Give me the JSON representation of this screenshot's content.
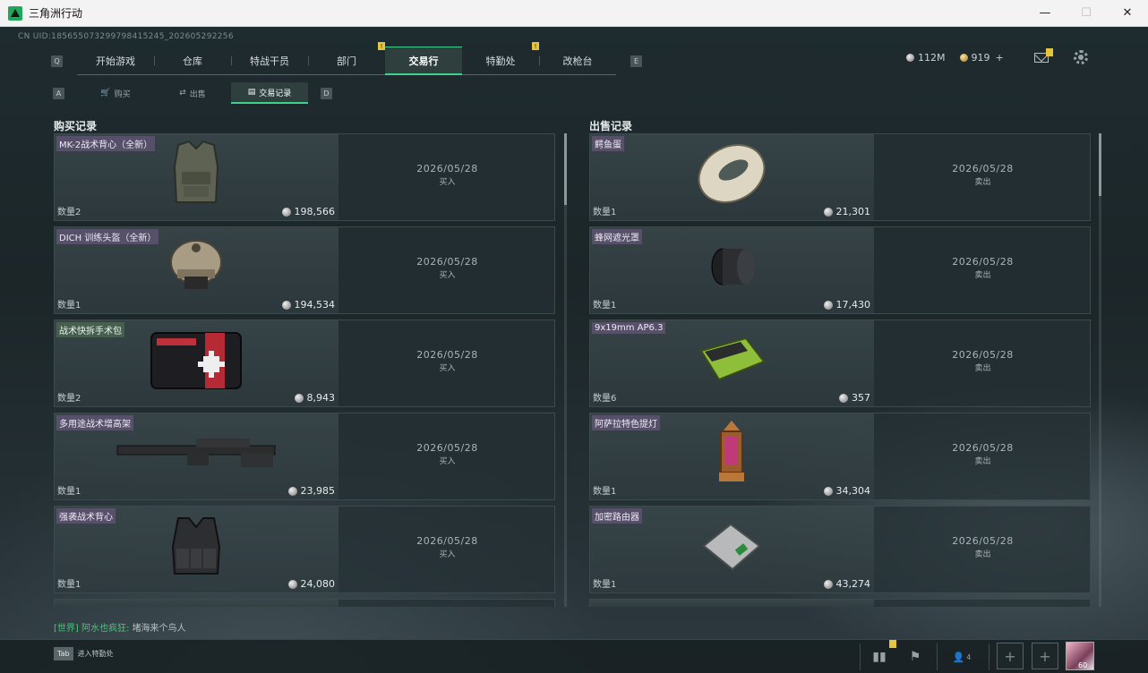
{
  "window": {
    "title": "三角洲行动",
    "minimize": "—",
    "maximize": "☐",
    "close": "✕"
  },
  "uid": "CN UID:18565507329979841524​5_202605292256",
  "nav": {
    "left_key": "Q",
    "right_key": "E",
    "tabs": [
      {
        "label": "开始游戏"
      },
      {
        "label": "仓库"
      },
      {
        "label": "特战干员"
      },
      {
        "label": "部门",
        "badge": "!"
      },
      {
        "label": "交易行",
        "active": true
      },
      {
        "label": "特勤处",
        "badge": "!"
      },
      {
        "label": "改枪台"
      }
    ]
  },
  "currency": {
    "silver": "112M",
    "gold": "919",
    "plus": "+"
  },
  "subnav": {
    "left_key": "A",
    "right_key": "D",
    "tabs": [
      {
        "label": "购买",
        "icon": "cart-icon",
        "glyph": "🛒"
      },
      {
        "label": "出售",
        "icon": "sell-icon",
        "glyph": "⇄"
      },
      {
        "label": "交易记录",
        "icon": "record-icon",
        "glyph": "▤",
        "active": true
      }
    ]
  },
  "buy_title": "购买记录",
  "sell_title": "出售记录",
  "buy_records": [
    {
      "name": "MK-2战术背心（全新）",
      "qty": "数量2",
      "price": "198,566",
      "date": "2026/05/28",
      "kind": "买入",
      "art": "vest"
    },
    {
      "name": "DICH 训练头盔（全新）",
      "qty": "数量1",
      "price": "194,534",
      "date": "2026/05/28",
      "kind": "买入",
      "art": "helmet"
    },
    {
      "name": "战术快拆手术包",
      "qty": "数量2",
      "price": "8,943",
      "date": "2026/05/28",
      "kind": "买入",
      "art": "medkit",
      "green": true
    },
    {
      "name": "多用途战术增高架",
      "qty": "数量1",
      "price": "23,985",
      "date": "2026/05/28",
      "kind": "买入",
      "art": "rail"
    },
    {
      "name": "强袭战术背心",
      "qty": "数量1",
      "price": "24,080",
      "date": "2026/05/28",
      "kind": "买入",
      "art": "rig"
    }
  ],
  "sell_records": [
    {
      "name": "鳄鱼蛋",
      "qty": "数量1",
      "price": "21,301",
      "date": "2026/05/28",
      "kind": "卖出",
      "art": "egg"
    },
    {
      "name": "蜂网遮光罩",
      "qty": "数量1",
      "price": "17,430",
      "date": "2026/05/28",
      "kind": "卖出",
      "art": "shade"
    },
    {
      "name": "9x19mm AP6.3",
      "qty": "数量6",
      "price": "357",
      "date": "2026/05/28",
      "kind": "卖出",
      "art": "ammo"
    },
    {
      "name": "阿萨拉特色提灯",
      "qty": "数量1",
      "price": "34,304",
      "date": "2026/05/28",
      "kind": "卖出",
      "art": "lantern"
    },
    {
      "name": "加密路由器",
      "qty": "数量1",
      "price": "43,274",
      "date": "2026/05/28",
      "kind": "卖出",
      "art": "router"
    }
  ],
  "chat": {
    "channel": "[世界]",
    "user": "阿水也疯狂:",
    "message": "堵海来个鸟人"
  },
  "bottom": {
    "tab_key": "Tab",
    "tab_label": "进入特勤处",
    "friends": "4",
    "avatar_level": "60"
  },
  "colors": {
    "accent": "#3fd08c",
    "badge": "#e6c43b"
  }
}
